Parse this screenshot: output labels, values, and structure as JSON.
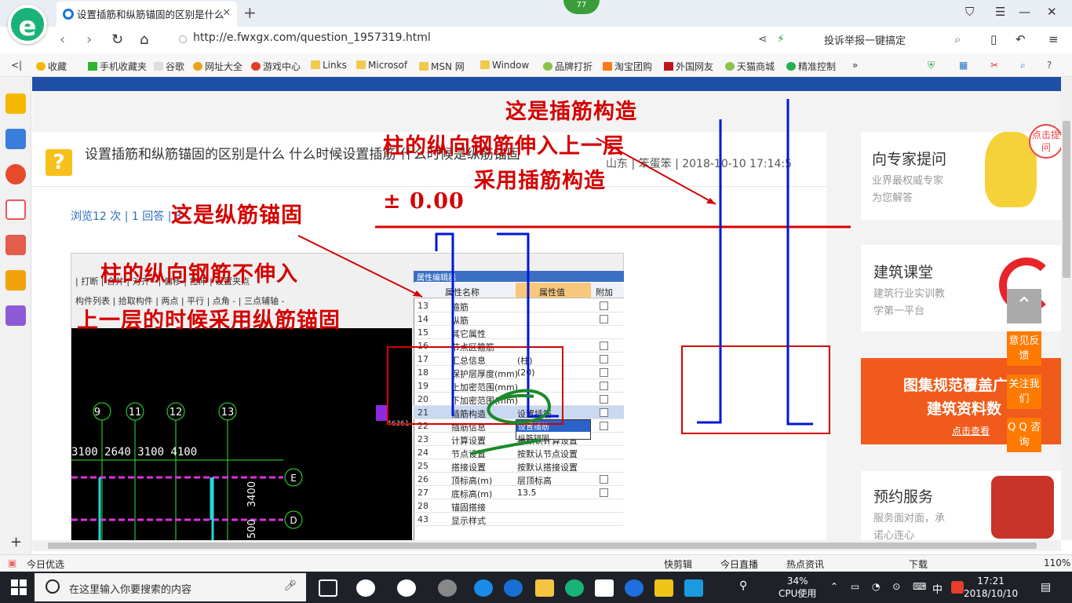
{
  "browser": {
    "logo": "e",
    "tab_title": "设置插筋和纵筋锚固的区别是什么",
    "badge": "77",
    "url": "http://e.fwxgx.com/question_1957319.html",
    "report": "投诉举报一键搞定",
    "bookmarks": [
      "收藏",
      "手机收藏夹",
      "谷歌",
      "网址大全",
      "游戏中心",
      "Links",
      "Microsof",
      "MSN 网",
      "Window",
      "品牌打折",
      "淘宝团购",
      "外国网友",
      "天猫商城",
      "精准控制"
    ]
  },
  "question": {
    "icon": "?",
    "title": "设置插筋和纵筋锚固的区别是什么 什么时候设置插筋 什么时候是纵筋锚固",
    "meta": "山东 | 笨蛋笨 | 2018-10-10 17:14:5",
    "stats": "浏览12 次 | 1 回答 | 3"
  },
  "cad": {
    "toolbar1": "| 打断 | 合并 | 对齐 - | 偏移 | 拉伸 | 设置夹点",
    "toolbar2": "构件列表 | 拾取构件 | 两点 | 平行 | 点角 - | 三点辅轴 -",
    "axis_nums": [
      "9",
      "11",
      "12",
      "13"
    ],
    "dims": "3100 2640 3100    4100",
    "letters": [
      "E",
      "D"
    ],
    "vdims": [
      "3400",
      "500"
    ],
    "coord": "46361"
  },
  "properties": {
    "title": "属性编辑器",
    "col_name": "属性名称",
    "col_value": "属性值",
    "col_extra": "附加",
    "rows": [
      {
        "n": "13",
        "k": "箍筋",
        "v": ""
      },
      {
        "n": "14",
        "k": "纵筋",
        "v": ""
      },
      {
        "n": "15",
        "k": "其它属性",
        "v": ""
      },
      {
        "n": "16",
        "k": "节点区箍筋",
        "v": ""
      },
      {
        "n": "17",
        "k": "汇总信息",
        "v": "(柱)"
      },
      {
        "n": "18",
        "k": "保护层厚度(mm)",
        "v": "(20)"
      },
      {
        "n": "19",
        "k": "上加密范围(mm)",
        "v": ""
      },
      {
        "n": "20",
        "k": "下加密范围(mm)",
        "v": ""
      },
      {
        "n": "21",
        "k": "插筋构造",
        "v": "设置插筋"
      },
      {
        "n": "22",
        "k": "插筋信息",
        "v": ""
      },
      {
        "n": "23",
        "k": "计算设置",
        "v": "按默认计算设置"
      },
      {
        "n": "24",
        "k": "节点设置",
        "v": "按默认节点设置"
      },
      {
        "n": "25",
        "k": "搭接设置",
        "v": "按默认搭接设置"
      },
      {
        "n": "26",
        "k": "顶标高(m)",
        "v": "层顶标高"
      },
      {
        "n": "27",
        "k": "底标高(m)",
        "v": "13.5"
      },
      {
        "n": "28",
        "k": "锚固搭接",
        "v": ""
      },
      {
        "n": "43",
        "k": "显示样式",
        "v": ""
      }
    ],
    "dropdown": [
      "设置插筋",
      "纵筋锚固"
    ]
  },
  "annotations": {
    "a1": "这是插筋构造",
    "a2": "柱的纵向钢筋伸入上一层",
    "a3": "采用插筋构造",
    "a4": "± 0.00",
    "a5": "这是纵筋锚固",
    "a6": "柱的纵向钢筋不伸入",
    "a7": "上一层的时候采用纵筋锚固"
  },
  "right": {
    "c1_title": "向专家提问",
    "c1_sub1": "业界最权威专家",
    "c1_sub2": "为您解答",
    "c1_pop": "点击提问",
    "c2_title": "建筑课堂",
    "c2_sub1": "建筑行业实训教",
    "c2_sub2": "学第一平台",
    "c3_line1": "图集规范覆盖广",
    "c3_line2": "建筑资料数",
    "c3_link": "点击查看",
    "c4_title": "预约服务",
    "c4_sub1": "服务面对面，承",
    "c4_sub2": "诺心连心",
    "btn1": "意见反馈",
    "btn2": "关注我们",
    "btn3": "Q Q 咨询"
  },
  "status": {
    "left": "今日优选",
    "items": [
      "快剪辑",
      "今日直播",
      "热点资讯",
      "下载",
      "110%"
    ]
  },
  "taskbar": {
    "search": "在这里输入你要搜索的内容",
    "cpu": "34%",
    "cpu_label": "CPU使用",
    "ime": "中",
    "time": "17:21",
    "date": "2018/10/10"
  }
}
